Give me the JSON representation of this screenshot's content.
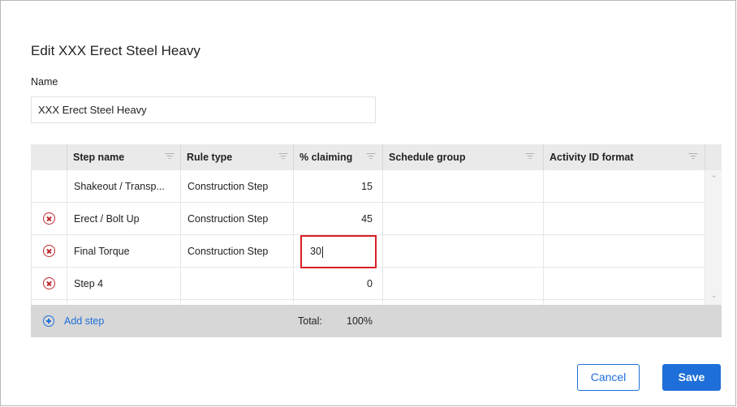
{
  "dialog": {
    "title": "Edit XXX Erect Steel Heavy",
    "name_label": "Name",
    "name_value": "XXX Erect Steel Heavy"
  },
  "grid": {
    "columns": [
      {
        "label": "Step name"
      },
      {
        "label": "Rule type"
      },
      {
        "label": "% claiming"
      },
      {
        "label": "Schedule group"
      },
      {
        "label": "Activity ID format"
      }
    ],
    "rows": [
      {
        "step_name": "Shakeout / Transp...",
        "rule_type": "Construction Step",
        "claiming": "15",
        "schedule_group": "",
        "activity_id_format": "",
        "deletable": false
      },
      {
        "step_name": "Erect / Bolt Up",
        "rule_type": "Construction Step",
        "claiming": "45",
        "schedule_group": "",
        "activity_id_format": "",
        "deletable": true
      },
      {
        "step_name": "Final Torque",
        "rule_type": "Construction Step",
        "claiming": "30",
        "schedule_group": "",
        "activity_id_format": "",
        "deletable": true
      },
      {
        "step_name": "Step 4",
        "rule_type": "",
        "claiming": "0",
        "schedule_group": "",
        "activity_id_format": "",
        "deletable": true
      }
    ],
    "footer": {
      "add_step_label": "Add step",
      "total_label": "Total:",
      "total_value": "100%"
    }
  },
  "buttons": {
    "cancel_label": "Cancel",
    "save_label": "Save"
  },
  "colors": {
    "accent": "#1e6fd9",
    "delete": "#c0262d",
    "edit_highlight": "#d81e25"
  },
  "icons": {
    "filter": "filter-icon",
    "delete": "remove-circle-icon",
    "add": "add-circle-icon"
  }
}
